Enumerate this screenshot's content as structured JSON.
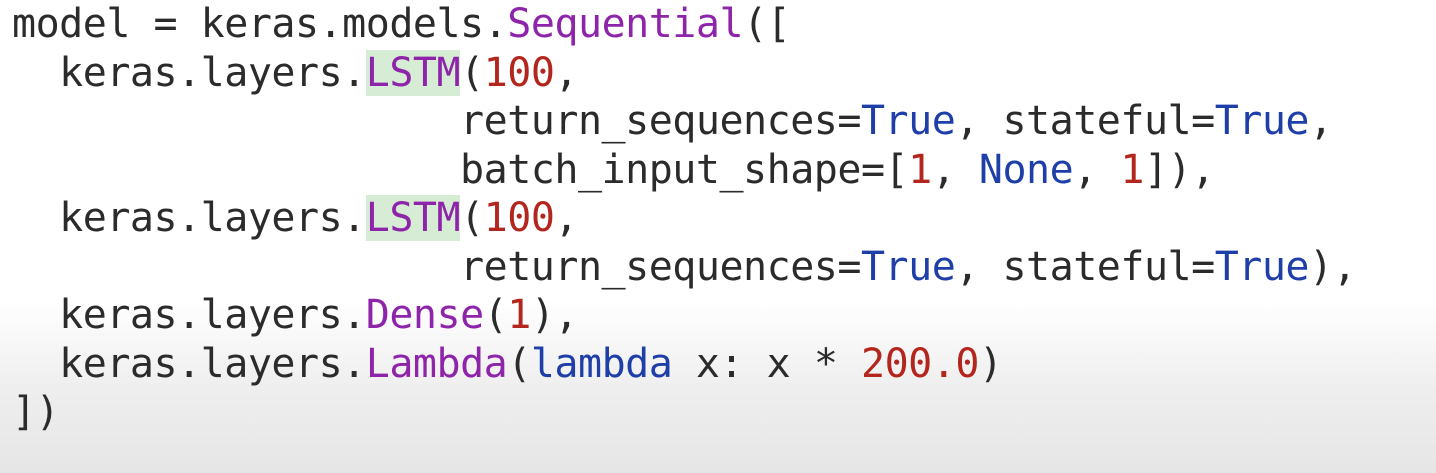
{
  "colors": {
    "text": "#2b2b2b",
    "class_name": "#8e24aa",
    "number": "#b3261e",
    "keyword": "#1f3fa8",
    "highlight": "#d7ecd4"
  },
  "code": {
    "line1": {
      "a": "model = keras.models.",
      "b": "Sequential",
      "c": "(["
    },
    "line2": {
      "a": "  keras.layers.",
      "b": "LSTM",
      "c": "(",
      "d": "100",
      "e": ","
    },
    "line3": {
      "a": "                   return_sequences=",
      "b": "True",
      "c": ", stateful=",
      "d": "True",
      "e": ","
    },
    "line4": {
      "a": "                   batch_input_shape=[",
      "b": "1",
      "c": ", ",
      "d": "None",
      "e": ", ",
      "f": "1",
      "g": "]),"
    },
    "line5": {
      "a": "  keras.layers.",
      "b": "LSTM",
      "c": "(",
      "d": "100",
      "e": ","
    },
    "line6": {
      "a": "                   return_sequences=",
      "b": "True",
      "c": ", stateful=",
      "d": "True",
      "e": "),"
    },
    "line7": {
      "a": "  keras.layers.",
      "b": "Dense",
      "c": "(",
      "d": "1",
      "e": "),"
    },
    "line8": {
      "a": "  keras.layers.",
      "b": "Lambda",
      "c": "(",
      "d": "lambda",
      "e": " x: x * ",
      "f": "200.0",
      "g": ")"
    },
    "line9": {
      "a": "])"
    }
  }
}
